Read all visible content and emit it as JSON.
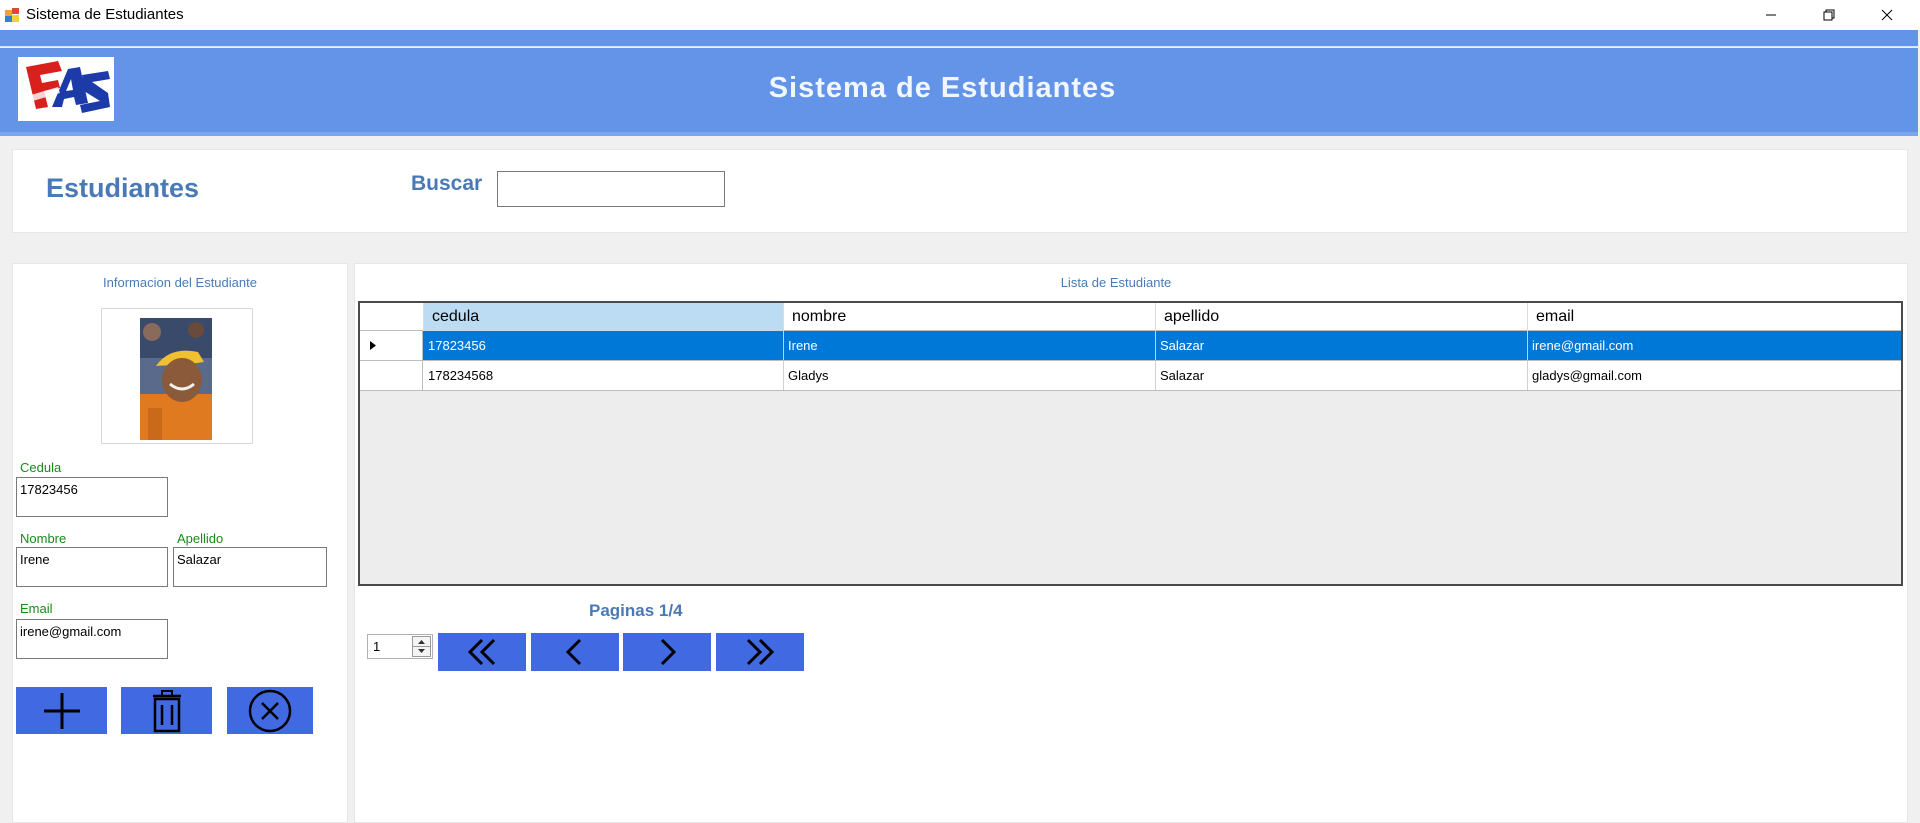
{
  "window": {
    "title": "Sistema de Estudiantes"
  },
  "banner": {
    "title": "Sistema de Estudiantes",
    "logo_icon": "fas-logo"
  },
  "search": {
    "section_title": "Estudiantes",
    "label": "Buscar",
    "value": ""
  },
  "student_info": {
    "caption": "Informacion del Estudiante",
    "photo_icon": "student-photo",
    "cedula_label": "Cedula",
    "cedula_value": "17823456",
    "nombre_label": "Nombre",
    "nombre_value": "Irene",
    "apellido_label": "Apellido",
    "apellido_value": "Salazar",
    "email_label": "Email",
    "email_value": "irene@gmail.com",
    "actions": [
      "plus-icon",
      "trash-icon",
      "cancel-circle-icon"
    ]
  },
  "list": {
    "caption": "Lista de Estudiante",
    "columns": [
      "cedula",
      "nombre",
      "apellido",
      "email"
    ],
    "rows": [
      [
        "17823456",
        "Irene",
        "Salazar",
        "irene@gmail.com"
      ],
      [
        "178234568",
        "Gladys",
        "Salazar",
        "gladys@gmail.com"
      ]
    ],
    "selected_row": 0
  },
  "pagination": {
    "label": "Paginas 1/4",
    "page_value": "1",
    "buttons": [
      "first-page-icon",
      "prev-page-icon",
      "next-page-icon",
      "last-page-icon"
    ]
  },
  "colors": {
    "accent": "#6394e8",
    "button": "#4169e1",
    "selection": "#0078d7",
    "label_blue": "#4a7ab5",
    "label_green": "#1a8a1a"
  }
}
